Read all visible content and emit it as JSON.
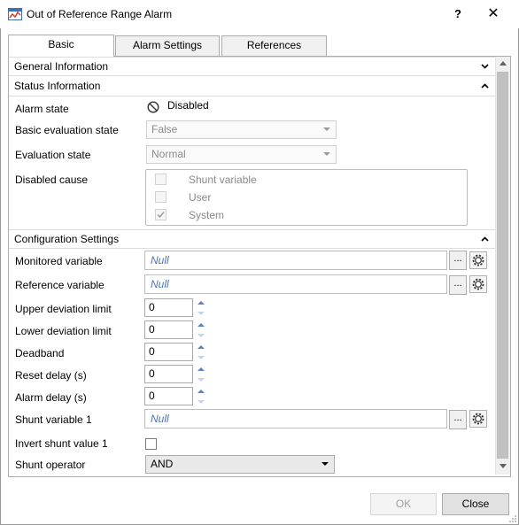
{
  "window": {
    "title": "Out of Reference Range Alarm",
    "help_label": "?",
    "close_label": "✕"
  },
  "tabs": [
    {
      "label": "Basic"
    },
    {
      "label": "Alarm Settings"
    },
    {
      "label": "References"
    }
  ],
  "sections": {
    "general": "General Information",
    "status": "Status Information",
    "config": "Configuration Settings"
  },
  "status": {
    "alarm_state_label": "Alarm state",
    "alarm_state_value": "Disabled",
    "basic_eval_label": "Basic evaluation state",
    "basic_eval_value": "False",
    "eval_label": "Evaluation state",
    "eval_value": "Normal",
    "disabled_cause_label": "Disabled cause",
    "causes": [
      {
        "label": "Shunt variable",
        "checked": false
      },
      {
        "label": "User",
        "checked": false
      },
      {
        "label": "System",
        "checked": true
      }
    ]
  },
  "config": {
    "monitored_label": "Monitored variable",
    "monitored_value": "Null",
    "reference_label": "Reference variable",
    "reference_value": "Null",
    "upper_label": "Upper deviation limit",
    "upper_value": "0",
    "lower_label": "Lower deviation limit",
    "lower_value": "0",
    "deadband_label": "Deadband",
    "deadband_value": "0",
    "reset_label": "Reset delay (s)",
    "reset_value": "0",
    "alarm_delay_label": "Alarm delay (s)",
    "alarm_delay_value": "0",
    "shunt1_label": "Shunt variable 1",
    "shunt1_value": "Null",
    "invert_label": "Invert shunt value 1",
    "shunt_op_label": "Shunt operator",
    "shunt_op_value": "AND",
    "browse_label": "..."
  },
  "footer": {
    "ok_label": "OK",
    "close_label": "Close"
  },
  "icons": [
    "app-icon",
    "help-icon",
    "close-icon",
    "disabled-icon",
    "gear-icon",
    "chevron-down-icon",
    "chevron-up-icon"
  ]
}
